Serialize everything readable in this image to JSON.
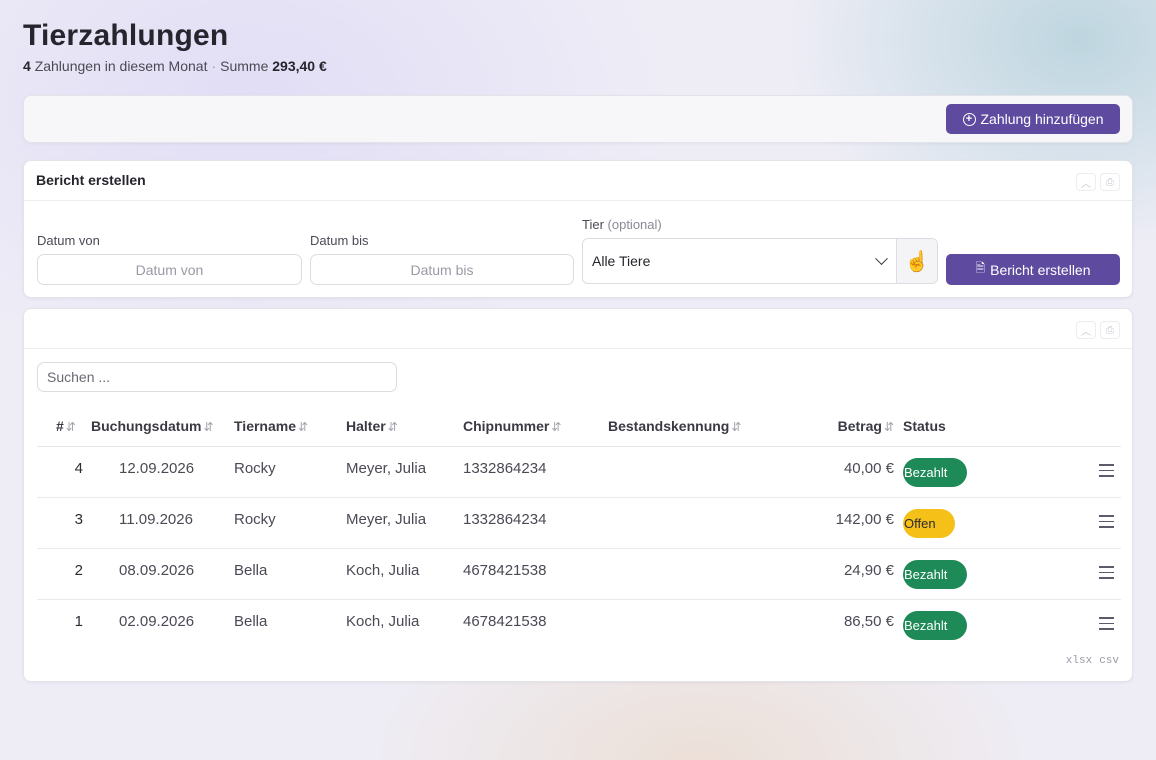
{
  "page": {
    "title": "Tierzahlungen",
    "count": "4",
    "count_text": "Zahlungen in diesem Monat",
    "separator": "·",
    "sum_label": "Summe",
    "sum_value": "293,40 €"
  },
  "toolbar": {
    "add_label": "Zahlung hinzufügen",
    "add_icon": "plus-circle-icon"
  },
  "report": {
    "title": "Bericht erstellen",
    "date_from_label": "Datum von",
    "date_from_placeholder": "Datum von",
    "date_to_label": "Datum bis",
    "date_to_placeholder": "Datum bis",
    "animal_label": "Tier",
    "animal_optional": "(optional)",
    "animal_value": "Alle Tiere",
    "button_label": "Bericht erstellen",
    "button_icon": "document-icon"
  },
  "table": {
    "search_placeholder": "Suchen ...",
    "columns": [
      "#",
      "Buchungsdatum",
      "Tiername",
      "Halter",
      "Chipnummer",
      "Bestandskennung",
      "Betrag",
      "Status"
    ],
    "rows": [
      {
        "nr": "4",
        "date": "12.09.2026",
        "name": "Rocky",
        "owner": "Meyer, Julia",
        "chip": "1332864234",
        "stock": "",
        "amount": "40,00 €",
        "status": "Bezahlt",
        "status_type": "paid"
      },
      {
        "nr": "3",
        "date": "11.09.2026",
        "name": "Rocky",
        "owner": "Meyer, Julia",
        "chip": "1332864234",
        "stock": "",
        "amount": "142,00 €",
        "status": "Offen",
        "status_type": "open"
      },
      {
        "nr": "2",
        "date": "08.09.2026",
        "name": "Bella",
        "owner": "Koch, Julia",
        "chip": "4678421538",
        "stock": "",
        "amount": "24,90 €",
        "status": "Bezahlt",
        "status_type": "paid"
      },
      {
        "nr": "1",
        "date": "02.09.2026",
        "name": "Bella",
        "owner": "Koch, Julia",
        "chip": "4678421538",
        "stock": "",
        "amount": "86,50 €",
        "status": "Bezahlt",
        "status_type": "paid"
      }
    ],
    "export_xlsx": "xlsx",
    "export_csv": "csv"
  },
  "colors": {
    "primary": "#5e4b9f",
    "paid": "#1e8a57",
    "open": "#f5c017"
  }
}
